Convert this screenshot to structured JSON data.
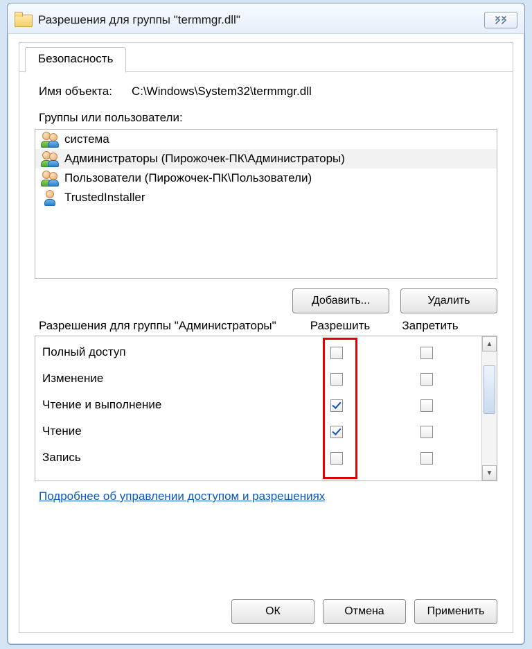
{
  "window": {
    "title": "Разрешения для группы \"termmgr.dll\""
  },
  "tab": {
    "security": "Безопасность"
  },
  "object": {
    "label": "Имя объекта:",
    "path": "C:\\Windows\\System32\\termmgr.dll"
  },
  "groups": {
    "label": "Группы или пользователи:",
    "items": [
      {
        "name": "система",
        "icon": "users"
      },
      {
        "name": "Администраторы (Пирожочек-ПК\\Администраторы)",
        "icon": "users",
        "selected": true
      },
      {
        "name": "Пользователи (Пирожочек-ПК\\Пользователи)",
        "icon": "users"
      },
      {
        "name": "TrustedInstaller",
        "icon": "user"
      }
    ]
  },
  "buttons": {
    "add": "Добавить...",
    "remove": "Удалить",
    "ok": "ОК",
    "cancel": "Отмена",
    "apply": "Применить"
  },
  "permissions": {
    "header_for": "Разрешения для группы \"Администраторы\"",
    "col_allow": "Разрешить",
    "col_deny": "Запретить",
    "rows": [
      {
        "name": "Полный доступ",
        "allow": false,
        "deny": false
      },
      {
        "name": "Изменение",
        "allow": false,
        "deny": false
      },
      {
        "name": "Чтение и выполнение",
        "allow": true,
        "deny": false
      },
      {
        "name": "Чтение",
        "allow": true,
        "deny": false
      },
      {
        "name": "Запись",
        "allow": false,
        "deny": false
      }
    ]
  },
  "link": {
    "text": "Подробнее об управлении доступом и разрешениях"
  }
}
